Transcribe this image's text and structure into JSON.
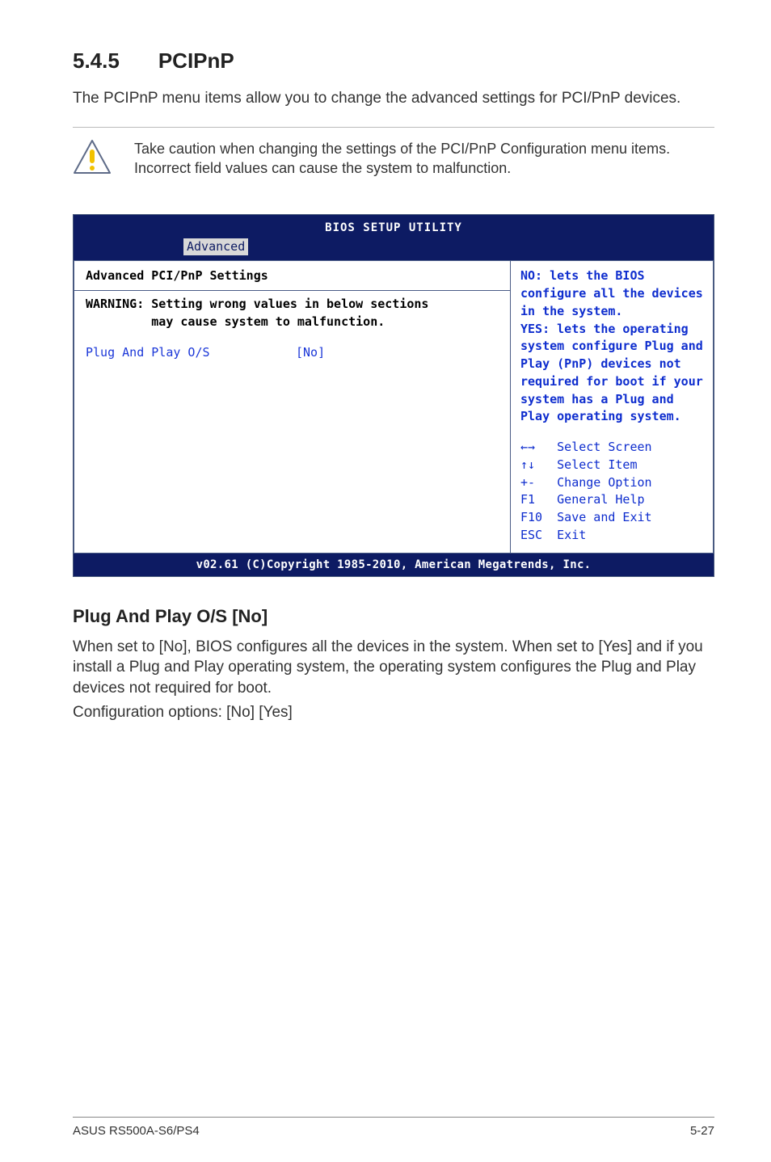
{
  "section": {
    "number": "5.4.5",
    "title": "PCIPnP",
    "intro": "The PCIPnP menu items allow you to change the advanced settings for PCI/PnP devices.",
    "note": "Take caution when changing the settings of the PCI/PnP Configuration menu items. Incorrect field values can cause the system to malfunction."
  },
  "bios": {
    "title": "BIOS SETUP UTILITY",
    "active_tab": "Advanced",
    "left": {
      "heading": "Advanced PCI/PnP Settings",
      "warning": "WARNING: Setting wrong values in below sections\n         may cause system to malfunction.",
      "row_label": "Plug And Play O/S",
      "row_value": "[No]"
    },
    "right": {
      "help": "NO: lets the BIOS configure all the devices in the system.\nYES: lets the operating system configure Plug and Play (PnP) devices not required for boot if your system has a Plug and Play operating system.",
      "keys": "←→   Select Screen\n↑↓   Select Item\n+-   Change Option\nF1   General Help\nF10  Save and Exit\nESC  Exit"
    },
    "footer": "v02.61 (C)Copyright 1985-2010, American Megatrends, Inc."
  },
  "sub": {
    "heading": "Plug And Play O/S [No]",
    "para1": "When set to [No], BIOS configures all the devices in the system. When set to [Yes] and if you install a Plug and Play operating system, the operating system configures the Plug and Play devices not required for boot.",
    "para2": "Configuration options: [No] [Yes]"
  },
  "footer": {
    "product": "ASUS RS500A-S6/PS4",
    "page": "5-27"
  }
}
